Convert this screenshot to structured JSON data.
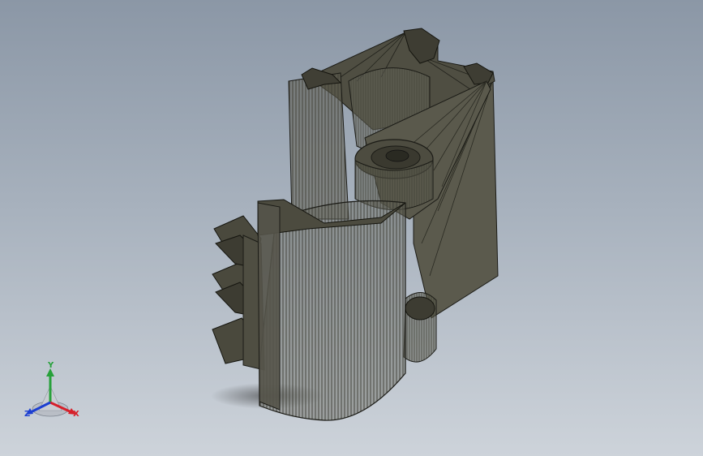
{
  "viewport": {
    "background_top": "#8b97a6",
    "background_bottom": "#cdd3da",
    "model_color": "#58574a",
    "model_edge_color": "#1b1b16",
    "view": "isometric"
  },
  "triad": {
    "x_label": "X",
    "y_label": "Y",
    "z_label": "Z",
    "x_color": "#d6202a",
    "y_color": "#27a13a",
    "z_color": "#1c3fd1"
  }
}
